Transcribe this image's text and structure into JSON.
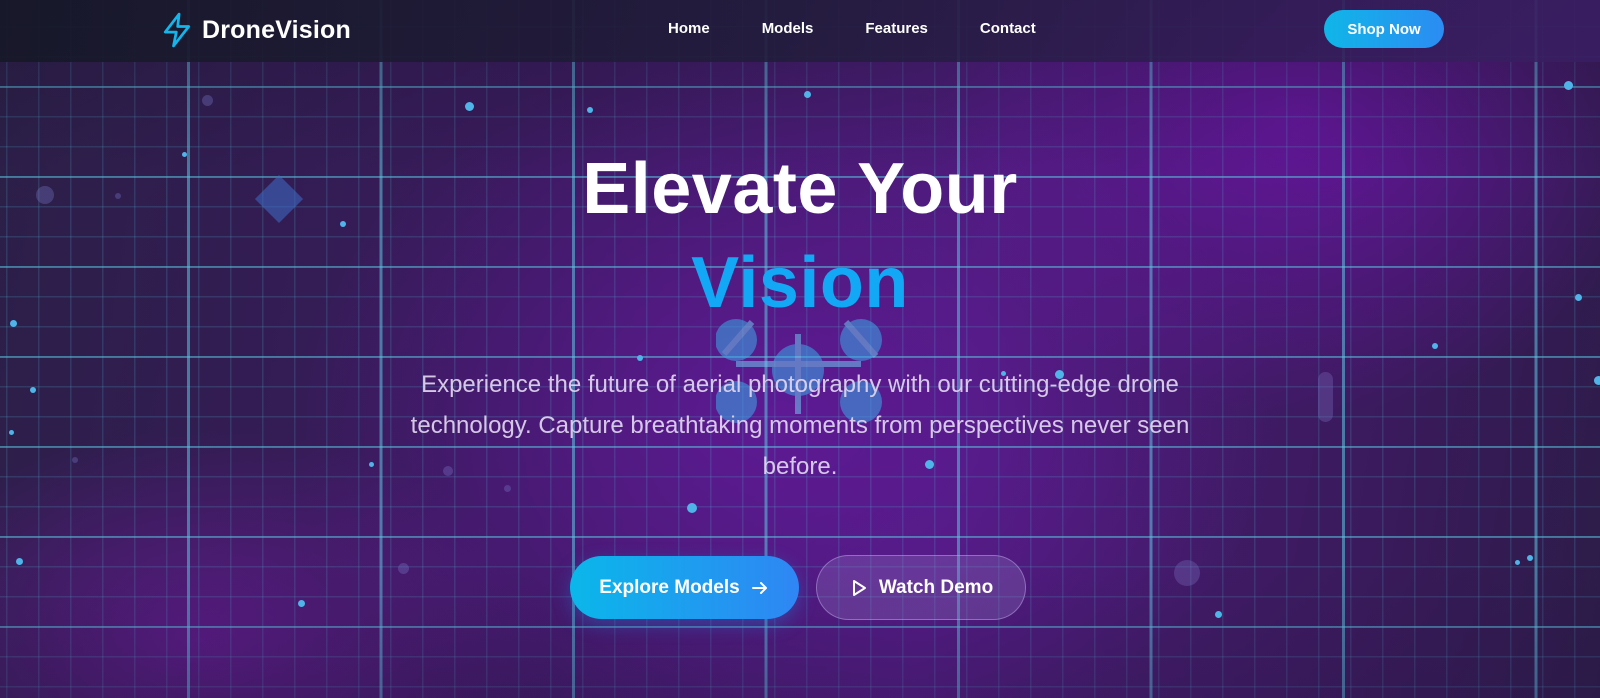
{
  "nav": {
    "brand": "DroneVision",
    "brand_icon": "lightning-bolt-icon",
    "links": [
      "Home",
      "Models",
      "Features",
      "Contact"
    ],
    "cta": "Shop Now"
  },
  "hero": {
    "title_line1": "Elevate Your",
    "title_line2": "Vision",
    "subtitle": "Experience the future of aerial photography with our cutting-edge drone technology. Capture breathtaking moments from perspectives never seen before.",
    "primary_button": "Explore Models",
    "primary_button_icon": "arrow-right-icon",
    "secondary_button": "Watch Demo",
    "secondary_button_icon": "play-icon",
    "background_icon": "drone-icon"
  },
  "colors": {
    "accent": "#12a8f5",
    "button_gradient_start": "#0ab7ea",
    "button_gradient_end": "#2f86f4",
    "background": "#3a1a5e"
  }
}
